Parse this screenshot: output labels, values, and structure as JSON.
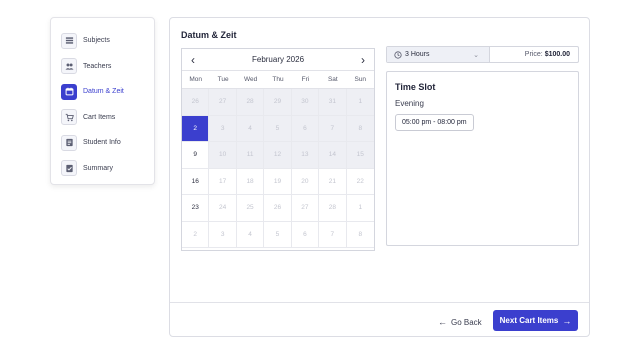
{
  "sidebar": {
    "items": [
      {
        "label": "Subjects",
        "icon": "list-icon",
        "active": false
      },
      {
        "label": "Teachers",
        "icon": "people-icon",
        "active": false
      },
      {
        "label": "Datum & Zeit",
        "icon": "calendar-icon",
        "active": true
      },
      {
        "label": "Cart Items",
        "icon": "cart-icon",
        "active": false
      },
      {
        "label": "Student Info",
        "icon": "info-card-icon",
        "active": false
      },
      {
        "label": "Summary",
        "icon": "checklist-icon",
        "active": false
      }
    ]
  },
  "main": {
    "title": "Datum & Zeit",
    "calendar": {
      "month_label": "February 2026",
      "prev_icon": "chevron-left-icon",
      "next_icon": "chevron-right-icon",
      "weekdays": [
        "Mon",
        "Tue",
        "Wed",
        "Thu",
        "Fri",
        "Sat",
        "Sun"
      ],
      "days": [
        {
          "label": "26",
          "state": "past"
        },
        {
          "label": "27",
          "state": "past"
        },
        {
          "label": "28",
          "state": "past"
        },
        {
          "label": "29",
          "state": "past"
        },
        {
          "label": "30",
          "state": "past"
        },
        {
          "label": "31",
          "state": "past"
        },
        {
          "label": "1",
          "state": "past"
        },
        {
          "label": "2",
          "state": "selected"
        },
        {
          "label": "3",
          "state": "past"
        },
        {
          "label": "4",
          "state": "past"
        },
        {
          "label": "5",
          "state": "past"
        },
        {
          "label": "6",
          "state": "past"
        },
        {
          "label": "7",
          "state": "past"
        },
        {
          "label": "8",
          "state": "past"
        },
        {
          "label": "9",
          "state": "avail-past"
        },
        {
          "label": "10",
          "state": "past"
        },
        {
          "label": "11",
          "state": "past"
        },
        {
          "label": "12",
          "state": "past"
        },
        {
          "label": "13",
          "state": "past"
        },
        {
          "label": "14",
          "state": "past"
        },
        {
          "label": "15",
          "state": "past"
        },
        {
          "label": "16",
          "state": "avail"
        },
        {
          "label": "17",
          "state": "other"
        },
        {
          "label": "18",
          "state": "other"
        },
        {
          "label": "19",
          "state": "other"
        },
        {
          "label": "20",
          "state": "other"
        },
        {
          "label": "21",
          "state": "other"
        },
        {
          "label": "22",
          "state": "other"
        },
        {
          "label": "23",
          "state": "avail"
        },
        {
          "label": "24",
          "state": "other"
        },
        {
          "label": "25",
          "state": "other"
        },
        {
          "label": "26",
          "state": "other"
        },
        {
          "label": "27",
          "state": "other"
        },
        {
          "label": "28",
          "state": "other"
        },
        {
          "label": "1",
          "state": "other"
        },
        {
          "label": "2",
          "state": "other"
        },
        {
          "label": "3",
          "state": "other"
        },
        {
          "label": "4",
          "state": "other"
        },
        {
          "label": "5",
          "state": "other"
        },
        {
          "label": "6",
          "state": "other"
        },
        {
          "label": "7",
          "state": "other"
        },
        {
          "label": "8",
          "state": "other"
        }
      ]
    },
    "duration": {
      "value": "3 Hours",
      "icon": "clock-icon"
    },
    "price": {
      "label": "Price:",
      "value": "$100.00"
    },
    "time_slot": {
      "title": "Time Slot",
      "period": "Evening",
      "slots": [
        "05:00 pm - 08:00 pm"
      ]
    }
  },
  "footer": {
    "back_label": "Go Back",
    "next_label": "Next Cart Items"
  },
  "colors": {
    "accent": "#3b3fce",
    "disabled_cell": "#eeeff4"
  }
}
